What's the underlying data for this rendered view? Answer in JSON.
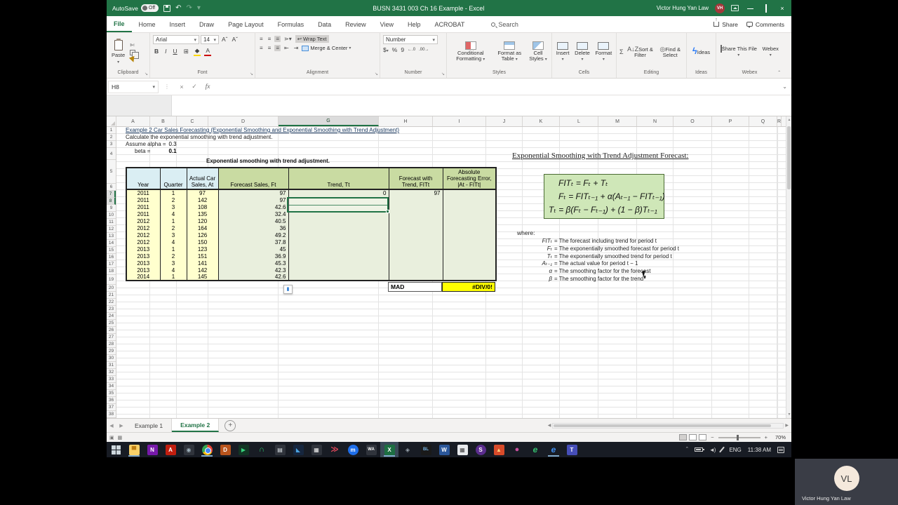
{
  "window": {
    "autosave_label": "AutoSave",
    "autosave_state": "Off",
    "title": "BUSN 3431 003 Ch 16 Example  -  Excel",
    "user_name": "Victor Hung Yan Law",
    "user_initials": "VH"
  },
  "ribbon_tabs": [
    "File",
    "Home",
    "Insert",
    "Draw",
    "Page Layout",
    "Formulas",
    "Data",
    "Review",
    "View",
    "Help",
    "ACROBAT"
  ],
  "search_label": "Search",
  "share_label": "Share",
  "comments_label": "Comments",
  "ribbon": {
    "paste": "Paste",
    "clipboard_group": "Clipboard",
    "font_name": "Arial",
    "font_size": "14",
    "bold": "B",
    "italic": "I",
    "underline": "U",
    "font_group": "Font",
    "wrap_text": "Wrap Text",
    "merge_center": "Merge & Center",
    "alignment_group": "Alignment",
    "number_format": "Number",
    "dollar": "$",
    "percent": "%",
    "comma": "9",
    "inc_dec": "←.0",
    "dec_dec": ".00→",
    "number_group": "Number",
    "conditional_formatting": "Conditional Formatting",
    "format_as_table": "Format as Table",
    "cell_styles": "Cell Styles",
    "styles_group": "Styles",
    "insert": "Insert",
    "delete": "Delete",
    "format": "Format",
    "cells_group": "Cells",
    "sigma": "Σ",
    "sort_filter": "Sort & Filter",
    "find_select": "Find & Select",
    "editing_group": "Editing",
    "ideas": "Ideas",
    "ideas_group": "Ideas",
    "share_this_file": "Share This File",
    "webex": "Webex",
    "webex_group": "Webex"
  },
  "formula_bar": {
    "name_box": "H8",
    "fx": "fx",
    "formula": ""
  },
  "grid": {
    "columns": [
      "A",
      "B",
      "C",
      "D",
      "G",
      "H",
      "I",
      "J",
      "K",
      "L",
      "M",
      "N",
      "O",
      "P",
      "Q",
      "R"
    ],
    "row_numbers": [
      "1",
      "2",
      "3",
      "4",
      "5",
      "6",
      "7",
      "8",
      "9",
      "10",
      "11",
      "12",
      "13",
      "14",
      "15",
      "16",
      "17",
      "18",
      "19",
      "20",
      "21",
      "22",
      "23",
      "24",
      "25",
      "26",
      "27",
      "28",
      "29",
      "30",
      "31",
      "32",
      "33",
      "34",
      "35",
      "36",
      "37",
      "38"
    ]
  },
  "sheet": {
    "line1": "Example 2 Car Sales Forecasting (Exponential Smoothing and Exponential Smoothing with Trend Adjustment)",
    "line2": "Calculate the exponential smoothing with trend adjustment.",
    "alpha_label": "Assume alpha =",
    "alpha_value": "0.3",
    "beta_label": "beta =",
    "beta_value": "0.1",
    "caption": "Exponential smoothing with trend adjustment.",
    "headers": [
      "Year",
      "Quarter",
      "Actual Car Sales, At",
      "Forecast Sales, Ft",
      "Trend, Tt",
      "Forecast with Trend, FITt",
      "Absolute Forecasting Error, |At - FITt|"
    ],
    "rows": [
      [
        "2011",
        "1",
        "97",
        "97",
        "0",
        "97",
        ""
      ],
      [
        "2011",
        "2",
        "142",
        "97",
        "",
        "",
        ""
      ],
      [
        "2011",
        "3",
        "108",
        "42.6",
        "",
        "",
        ""
      ],
      [
        "2011",
        "4",
        "135",
        "32.4",
        "",
        "",
        ""
      ],
      [
        "2012",
        "1",
        "120",
        "40.5",
        "",
        "",
        ""
      ],
      [
        "2012",
        "2",
        "164",
        "36",
        "",
        "",
        ""
      ],
      [
        "2012",
        "3",
        "126",
        "49.2",
        "",
        "",
        ""
      ],
      [
        "2012",
        "4",
        "150",
        "37.8",
        "",
        "",
        ""
      ],
      [
        "2013",
        "1",
        "123",
        "45",
        "",
        "",
        ""
      ],
      [
        "2013",
        "2",
        "151",
        "36.9",
        "",
        "",
        ""
      ],
      [
        "2013",
        "3",
        "141",
        "45.3",
        "",
        "",
        ""
      ],
      [
        "2013",
        "4",
        "142",
        "42.3",
        "",
        "",
        ""
      ],
      [
        "2014",
        "1",
        "145",
        "42.6",
        "",
        "",
        ""
      ]
    ],
    "mad_label": "MAD",
    "mad_value": "#DIV/0!"
  },
  "panel": {
    "title": "Exponential Smoothing with Trend Adjustment Forecast:",
    "formulas": [
      "FITₜ = Fₜ + Tₜ",
      "Fₜ = FITₜ₋₁ + α(Aₜ₋₁ − FITₜ₋₁)",
      "Tₜ = β(Fₜ − Fₜ₋₁) + (1 − β)Tₜ₋₁"
    ],
    "where_label": "where:",
    "definitions": [
      {
        "term": "FITₜ",
        "def": "= The forecast including trend for period t"
      },
      {
        "term": "Fₜ",
        "def": "= The exponentially smoothed forecast for period t"
      },
      {
        "term": "Tₜ",
        "def": "= The exponentially smoothed trend for period t"
      },
      {
        "term": "Aₜ₋₁",
        "def": "= The actual value for period t − 1"
      },
      {
        "term": "α",
        "def": "= The smoothing factor for the forecast"
      },
      {
        "term": "β",
        "def": "= The smoothing factor for the trend"
      }
    ]
  },
  "tabs": {
    "sheet1": "Example 1",
    "sheet2": "Example 2"
  },
  "status": {
    "zoom": "70%"
  },
  "taskbar": {
    "icons": [
      {
        "name": "file-explorer-icon",
        "glyph": "▀",
        "open": true
      },
      {
        "name": "onenote-icon",
        "glyph": "N",
        "open": false
      },
      {
        "name": "acrobat-icon",
        "glyph": "A",
        "open": false
      },
      {
        "name": "globe-icon",
        "glyph": "◉",
        "open": false
      },
      {
        "name": "chrome-icon",
        "glyph": "",
        "open": true
      },
      {
        "name": "download-manager-icon",
        "glyph": "D",
        "open": false
      },
      {
        "name": "media-player-icon",
        "glyph": "▶",
        "open": false
      },
      {
        "name": "headphones-icon",
        "glyph": "∩",
        "open": false
      },
      {
        "name": "notebook-icon",
        "glyph": "▤",
        "open": false
      },
      {
        "name": "video-player-icon",
        "glyph": "◣",
        "open": false
      },
      {
        "name": "movie-editor-icon",
        "glyph": "▦",
        "open": false
      },
      {
        "name": "red-arrows-icon",
        "glyph": "≫",
        "open": false
      },
      {
        "name": "video-call-icon",
        "glyph": "m",
        "open": false
      },
      {
        "name": "wa-app-icon",
        "glyph": "WA",
        "open": false
      },
      {
        "name": "excel-icon",
        "glyph": "X",
        "open": true,
        "active": true
      },
      {
        "name": "audio-device-icon",
        "glyph": "◈",
        "open": false
      },
      {
        "name": "blackboard-icon",
        "glyph": "BL",
        "open": false
      },
      {
        "name": "word-icon",
        "glyph": "W",
        "open": false
      },
      {
        "name": "calculator-icon",
        "glyph": "▦",
        "open": false
      },
      {
        "name": "skype-icon",
        "glyph": "S",
        "open": false
      },
      {
        "name": "flame-icon",
        "glyph": "▲",
        "open": false
      },
      {
        "name": "pin-icon",
        "glyph": "●",
        "open": false
      },
      {
        "name": "ie-browser-icon",
        "glyph": "e",
        "open": false
      },
      {
        "name": "edge-icon",
        "glyph": "e",
        "open": true
      },
      {
        "name": "teams-icon",
        "glyph": "T",
        "open": false
      }
    ],
    "tray": {
      "lang": "ENG",
      "time": "11:38 AM"
    }
  },
  "webcam": {
    "initials": "VL",
    "name": "Victor Hung Yan Law"
  }
}
